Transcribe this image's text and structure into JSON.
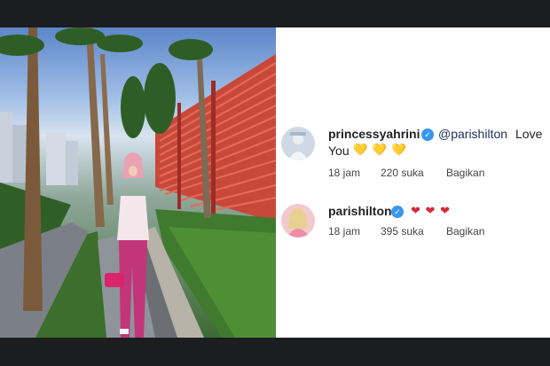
{
  "comments": [
    {
      "username": "princessyahrini",
      "mention": "@parishilton",
      "text_line1": "Love",
      "text_line2": "You",
      "emoji_hearts": [
        "💛",
        "💛",
        "💛"
      ],
      "time": "18 jam",
      "likes": "220 suka",
      "share": "Bagikan"
    },
    {
      "username": "parishilton",
      "emoji_hearts": [
        "❤",
        "❤",
        "❤"
      ],
      "time": "18 jam",
      "likes": "395 suka",
      "share": "Bagikan"
    }
  ],
  "icons": {
    "verified": "verified-badge-icon"
  },
  "colors": {
    "verified": "#3897f0",
    "fence": "#c8483a",
    "background": "#1c1d1f"
  }
}
